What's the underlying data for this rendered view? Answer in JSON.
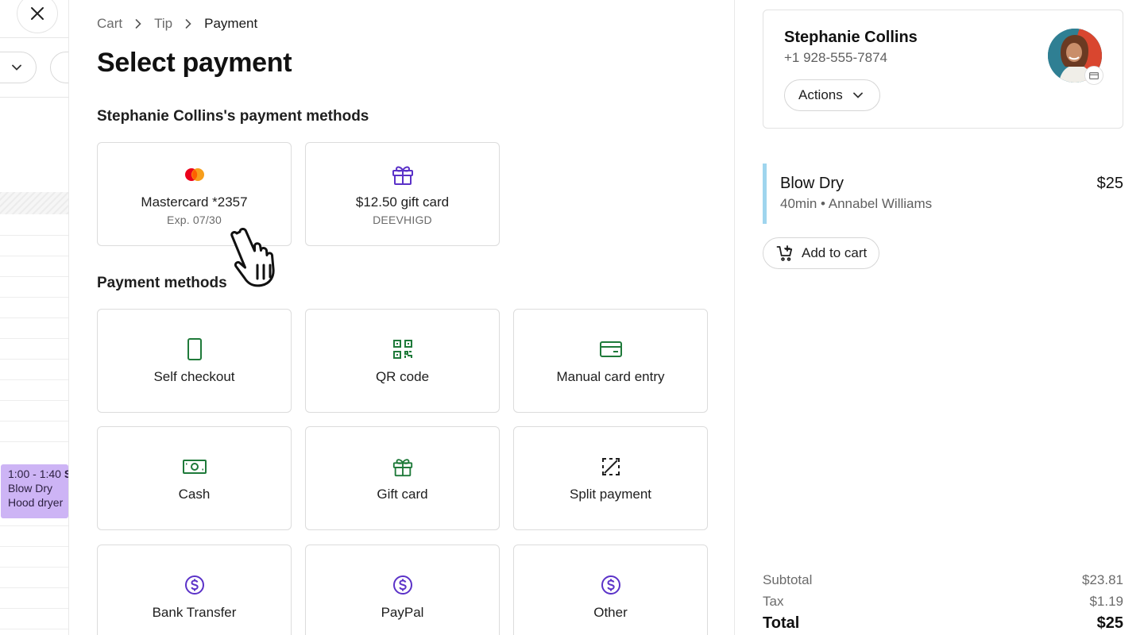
{
  "background_calendar": {
    "event": {
      "time": "1:00 - 1:40",
      "time_suffix": "S",
      "service": "Blow Dry",
      "resource": "Hood dryer"
    }
  },
  "breadcrumb": {
    "items": [
      "Cart",
      "Tip",
      "Payment"
    ]
  },
  "page_title": "Select payment",
  "saved_methods": {
    "title": "Stephanie Collins's payment methods",
    "cards": [
      {
        "label": "Mastercard *2357",
        "sub": "Exp. 07/30",
        "icon": "mastercard-icon"
      },
      {
        "label": "$12.50 gift card",
        "sub": "DEEVHIGD",
        "icon": "gift-icon"
      }
    ]
  },
  "payment_methods": {
    "title": "Payment methods",
    "items": [
      {
        "label": "Self checkout",
        "icon": "phone-icon"
      },
      {
        "label": "QR code",
        "icon": "qr-code-icon"
      },
      {
        "label": "Manual card entry",
        "icon": "credit-card-icon"
      },
      {
        "label": "Cash",
        "icon": "cash-icon"
      },
      {
        "label": "Gift card",
        "icon": "gift-icon"
      },
      {
        "label": "Split payment",
        "icon": "split-payment-icon"
      },
      {
        "label": "Bank Transfer",
        "icon": "dollar-circle-icon"
      },
      {
        "label": "PayPal",
        "icon": "dollar-circle-icon"
      },
      {
        "label": "Other",
        "icon": "dollar-circle-icon"
      }
    ]
  },
  "client": {
    "name": "Stephanie Collins",
    "phone": "+1 928-555-7874",
    "actions_label": "Actions"
  },
  "cart_item": {
    "name": "Blow Dry",
    "meta": "40min • Annabel Williams",
    "price": "$25"
  },
  "add_to_cart_label": "Add to cart",
  "summary": {
    "subtotal_label": "Subtotal",
    "subtotal": "$23.81",
    "tax_label": "Tax",
    "tax": "$1.19",
    "total_label": "Total",
    "total": "$25"
  },
  "colors": {
    "green_icon": "#1f7a3a",
    "purple_icon": "#5b32c8",
    "event_bg": "#cdb4f5",
    "service_accent": "#9fd5ee"
  }
}
